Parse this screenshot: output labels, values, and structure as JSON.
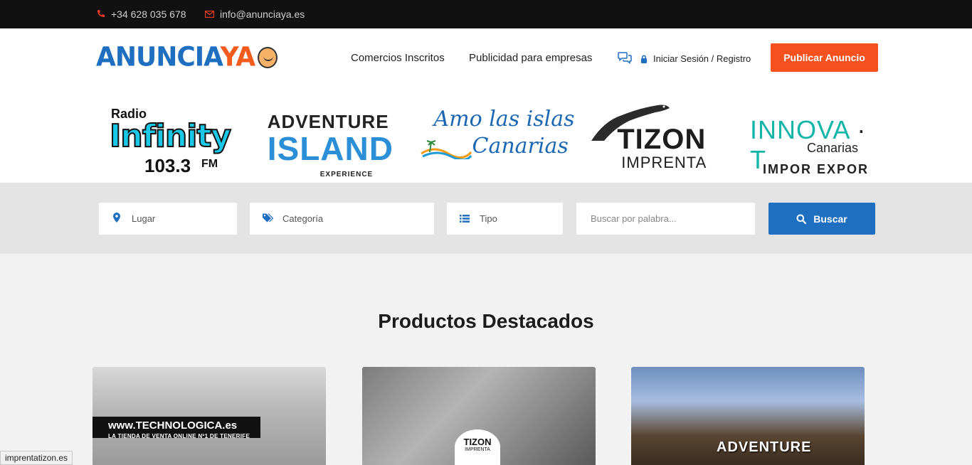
{
  "topbar": {
    "phone": "+34 628 035 678",
    "email": "info@anunciaya.es",
    "phone_icon": "phone-icon",
    "email_icon": "envelope-icon"
  },
  "header": {
    "logo_text_main": "ANUNCIA",
    "logo_text_accent": "YA",
    "nav": {
      "comercios": "Comercios Inscritos",
      "publicidad": "Publicidad para empresas"
    },
    "chat_icon": "chat-icon",
    "login_label": "Iniciar Sesión / Registro",
    "publish_label": "Publicar Anuncio",
    "colors": {
      "accent": "#f4511e",
      "brand": "#1f6fc1",
      "topbar": "#111111"
    }
  },
  "sponsors": {
    "radio": {
      "line1": "Radio",
      "line2": "Infinity",
      "line3": "103.3",
      "line4": "FM"
    },
    "adventure": {
      "line1": "ADVENTURE",
      "line2": "ISLAND",
      "line3": "EXPERIENCE"
    },
    "amo": {
      "line1": "Amo las islas",
      "line2": "Canarias"
    },
    "tizon": {
      "line1": "TIZON",
      "line2": "IMPRENTA"
    },
    "innova": {
      "line1a": "INNOVA",
      "line1b": "T",
      "line2": "Canarias",
      "line3": "IMPOR  EXPOR"
    }
  },
  "search": {
    "lugar": "Lugar",
    "categoria": "Categoría",
    "tipo": "Tipo",
    "keyword_placeholder": "Buscar por palabra...",
    "button_label": "Buscar"
  },
  "featured": {
    "title": "Productos Destacados",
    "cards": [
      {
        "banner": "www.TECHNOLOGICA.es",
        "tagline": "LA TIENDA DE VENTA ONLINE Nº1 DE TENERIFE"
      },
      {
        "badge": "TIZON",
        "badge_sub": "IMPRENTA"
      },
      {
        "overlay": "ADVENTURE"
      }
    ]
  },
  "status": {
    "url": "imprentatizon.es"
  }
}
